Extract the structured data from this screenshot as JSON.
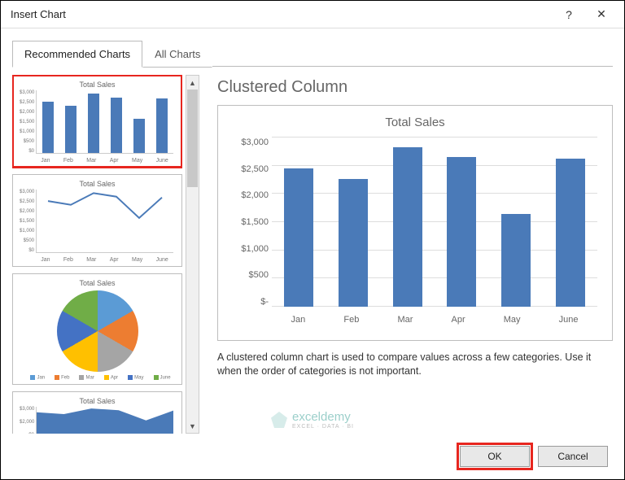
{
  "window": {
    "title": "Insert Chart",
    "help": "?",
    "close": "✕"
  },
  "tabs": {
    "recommended": "Recommended Charts",
    "all": "All Charts"
  },
  "thumb_title": "Total Sales",
  "preview": {
    "type_label": "Clustered Column",
    "title": "Total Sales",
    "description": "A clustered column chart is used to compare values across a few categories. Use it when the order of categories is not important."
  },
  "yticks": [
    "$-",
    "$500",
    "$1,000",
    "$1,500",
    "$2,000",
    "$2,500",
    "$3,000"
  ],
  "mini_yticks": [
    "$0",
    "$500",
    "$1,000",
    "$1,500",
    "$2,000",
    "$2,500",
    "$3,000"
  ],
  "categories": [
    "Jan",
    "Feb",
    "Mar",
    "Apr",
    "May",
    "June"
  ],
  "buttons": {
    "ok": "OK",
    "cancel": "Cancel"
  },
  "watermark": {
    "brand": "exceldemy",
    "tag": "EXCEL · DATA · BI"
  },
  "chart_data": {
    "type": "bar",
    "title": "Total Sales",
    "xlabel": "",
    "ylabel": "",
    "ylim": [
      0,
      3000
    ],
    "categories": [
      "Jan",
      "Feb",
      "Mar",
      "Apr",
      "May",
      "June"
    ],
    "values": [
      2450,
      2270,
      2830,
      2660,
      1640,
      2620
    ]
  }
}
